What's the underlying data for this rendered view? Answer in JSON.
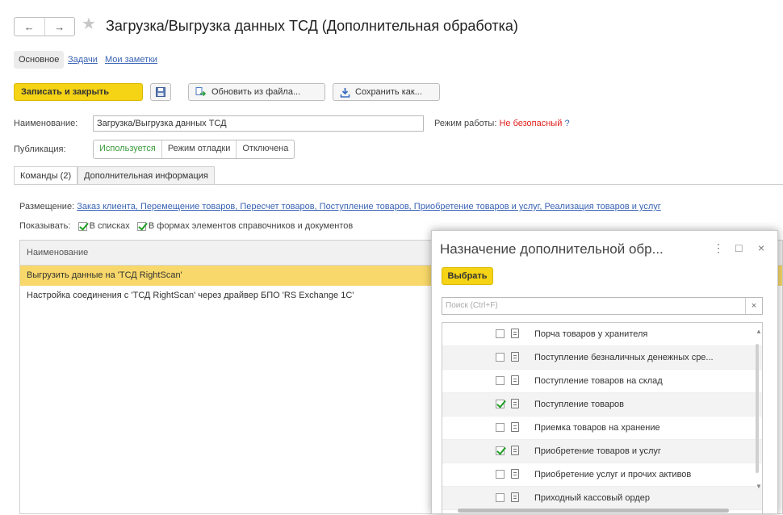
{
  "window": {
    "back": "←",
    "forward": "→",
    "title": "Загрузка/Выгрузка данных ТСД (Дополнительная обработка)"
  },
  "nav_tabs": {
    "main": "Основное",
    "tasks": "Задачи",
    "notes": "Мои заметки"
  },
  "toolbar": {
    "save_close": "Записать и закрыть",
    "update_from_file": "Обновить из файла...",
    "save_as": "Сохранить как..."
  },
  "form": {
    "name_label": "Наименование:",
    "name_value": "Загрузка/Выгрузка данных ТСД",
    "mode_label": "Режим работы:",
    "mode_value": "Не безопасный",
    "mode_help": "?",
    "publication_label": "Публикация:",
    "publication_options": [
      "Используется",
      "Режим отладки",
      "Отключена"
    ]
  },
  "tabs": [
    "Команды (2)",
    "Дополнительная информация"
  ],
  "placement": {
    "label": "Размещение:",
    "value": "Заказ клиента, Перемещение товаров, Пересчет товаров, Поступление товаров, Приобретение товаров и услуг, Реализация товаров и услуг"
  },
  "show": {
    "label": "Показывать:",
    "in_lists": "В списках",
    "in_forms": "В формах элементов справочников и документов"
  },
  "grid": {
    "header": "Наименование",
    "rows": [
      "Выгрузить данные на 'ТСД RightScan'",
      "Настройка соединения с 'ТСД RightScan' через драйвер БПО 'RS Exchange 1C'"
    ]
  },
  "dialog": {
    "title": "Назначение дополнительной обр...",
    "more": "⋮",
    "maximize": "□",
    "close": "×",
    "select_button": "Выбрать",
    "search_placeholder": "Поиск (Ctrl+F)",
    "search_clear": "×",
    "items": [
      {
        "label": "Порча товаров у хранителя",
        "checked": false
      },
      {
        "label": "Поступление безналичных денежных сре...",
        "checked": false
      },
      {
        "label": "Поступление товаров на склад",
        "checked": false
      },
      {
        "label": "Поступление товаров",
        "checked": true
      },
      {
        "label": "Приемка товаров на хранение",
        "checked": false
      },
      {
        "label": "Приобретение товаров и услуг",
        "checked": true
      },
      {
        "label": "Приобретение услуг и прочих активов",
        "checked": false
      },
      {
        "label": "Приходный кассовый ордер",
        "checked": false
      }
    ]
  },
  "colors": {
    "accent_yellow": "#f5d315",
    "link": "#3a63b4",
    "danger": "#e0201b",
    "check": "#1ea024"
  }
}
